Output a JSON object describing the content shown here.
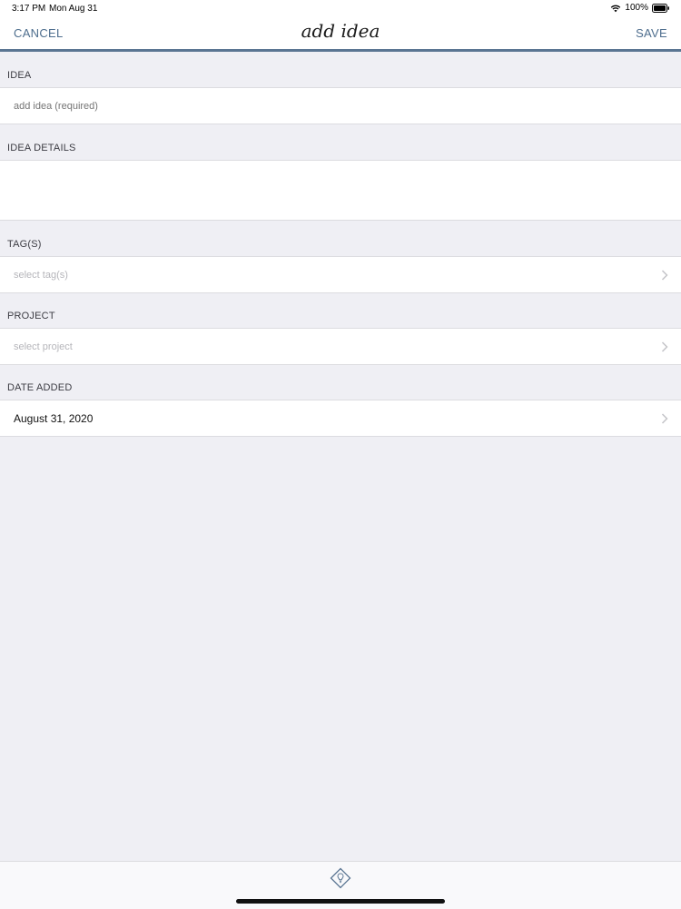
{
  "status_bar": {
    "time": "3:17 PM",
    "date": "Mon Aug 31",
    "battery": "100%"
  },
  "nav": {
    "cancel_label": "CANCEL",
    "title": "add idea",
    "save_label": "SAVE"
  },
  "form": {
    "idea": {
      "header": "IDEA",
      "placeholder": "add idea (required)"
    },
    "details": {
      "header": "IDEA DETAILS"
    },
    "tags": {
      "header": "TAG(S)",
      "placeholder": "select tag(s)"
    },
    "project": {
      "header": "PROJECT",
      "placeholder": "select project"
    },
    "date_added": {
      "header": "DATE ADDED",
      "value": "August 31, 2020"
    }
  },
  "colors": {
    "accent": "#4e6e8e",
    "nav_border": "#5a7592",
    "background": "#efeff4",
    "placeholder": "#b5b5ba"
  },
  "icons": {
    "wifi": "wifi-icon",
    "battery": "battery-icon",
    "chevron": "chevron-right-icon",
    "app": "lightbulb-diamond-icon"
  }
}
